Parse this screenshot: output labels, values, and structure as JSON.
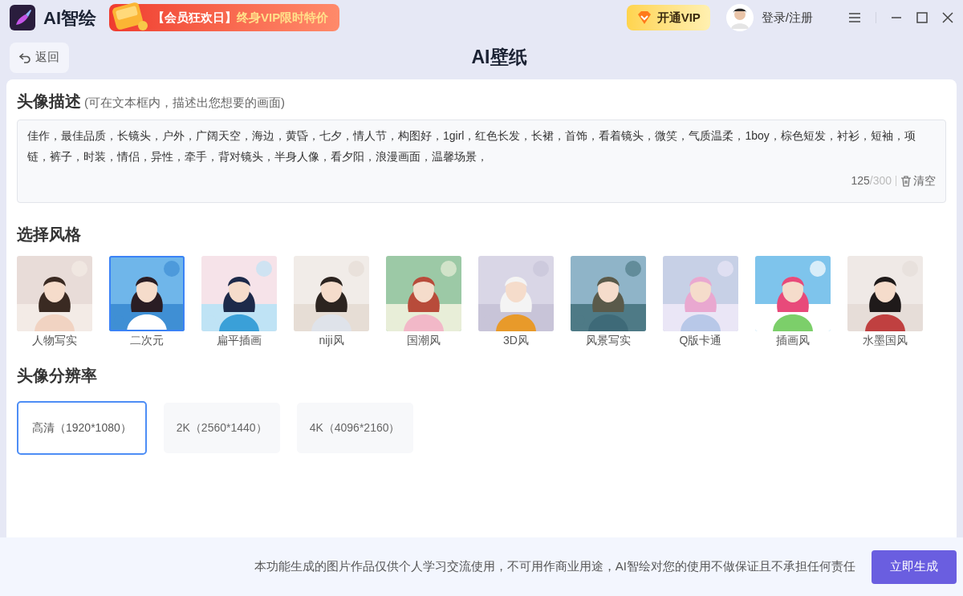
{
  "app": {
    "name": "AI智绘"
  },
  "promo": {
    "tag": "【会员狂欢日】",
    "text": "终身VIP限时特价"
  },
  "vip_button": {
    "label": "开通VIP"
  },
  "login": {
    "label": "登录/注册"
  },
  "back_button": {
    "label": "返回"
  },
  "page_title": "AI壁纸",
  "description": {
    "title": "头像描述",
    "hint": "(可在文本框内，描述出您想要的画面)",
    "value": "佳作，最佳品质，长镜头，户外，广阔天空，海边，黄昏，七夕，情人节，构图好，1girl，红色长发，长裙，首饰，看着镜头，微笑，气质温柔，1boy，棕色短发，衬衫，短袖，项链，裤子，时装，情侣，异性，牵手，背对镜头，半身人像，看夕阳，浪漫画面，温馨场景，",
    "count": "125",
    "max": "/300",
    "clear": "清空"
  },
  "styles": {
    "title": "选择风格",
    "items": [
      {
        "label": "人物写实",
        "selected": false
      },
      {
        "label": "二次元",
        "selected": true
      },
      {
        "label": "扁平插画",
        "selected": false
      },
      {
        "label": "niji风",
        "selected": false
      },
      {
        "label": "国潮风",
        "selected": false
      },
      {
        "label": "3D风",
        "selected": false
      },
      {
        "label": "风景写实",
        "selected": false
      },
      {
        "label": "Q版卡通",
        "selected": false
      },
      {
        "label": "插画风",
        "selected": false
      },
      {
        "label": "水墨国风",
        "selected": false
      }
    ]
  },
  "resolution": {
    "title": "头像分辨率",
    "items": [
      {
        "label": "高清（1920*1080）",
        "selected": true
      },
      {
        "label": "2K（2560*1440）",
        "selected": false
      },
      {
        "label": "4K（4096*2160）",
        "selected": false
      }
    ]
  },
  "footer": {
    "disclaimer": "本功能生成的图片作品仅供个人学习交流使用，不可用作商业用途，AI智绘对您的使用不做保证且不承担任何责任",
    "generate": "立即生成"
  }
}
